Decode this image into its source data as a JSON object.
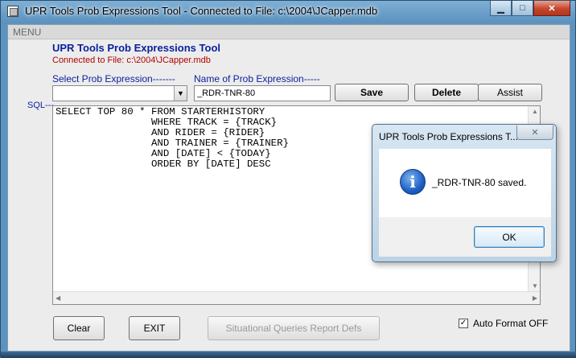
{
  "window": {
    "title": "UPR Tools Prob Expressions Tool - Connected to File: c:\\2004\\JCapper.mdb",
    "minimize_glyph": "▁",
    "maximize_glyph": "□",
    "close_glyph": "✕"
  },
  "menu": {
    "label": "MENU"
  },
  "header": {
    "title": "UPR Tools Prob Expressions Tool",
    "connected": "Connected to File: c:\\2004\\JCapper.mdb"
  },
  "form": {
    "select_label": "Select Prob Expression-------",
    "select_value": "",
    "name_label": "Name of Prob Expression-----",
    "name_value": "_RDR-TNR-80",
    "sql_label": "SQL---",
    "sql_text": "SELECT TOP 80 * FROM STARTERHISTORY\n                WHERE TRACK = {TRACK}\n                AND RIDER = {RIDER}\n                AND TRAINER = {TRAINER}\n                AND [DATE] < {TODAY}\n                ORDER BY [DATE] DESC"
  },
  "buttons": {
    "save": "Save",
    "delete": "Delete",
    "assist": "Assist",
    "clear": "Clear",
    "exit": "EXIT",
    "situational": "Situational Queries Report Defs"
  },
  "options": {
    "auto_format_label": "Auto Format OFF",
    "auto_format_checked": true
  },
  "dialog": {
    "title": "UPR Tools Prob Expressions T...",
    "message": "_RDR-TNR-80 saved.",
    "ok": "OK",
    "icon": "info-icon"
  }
}
